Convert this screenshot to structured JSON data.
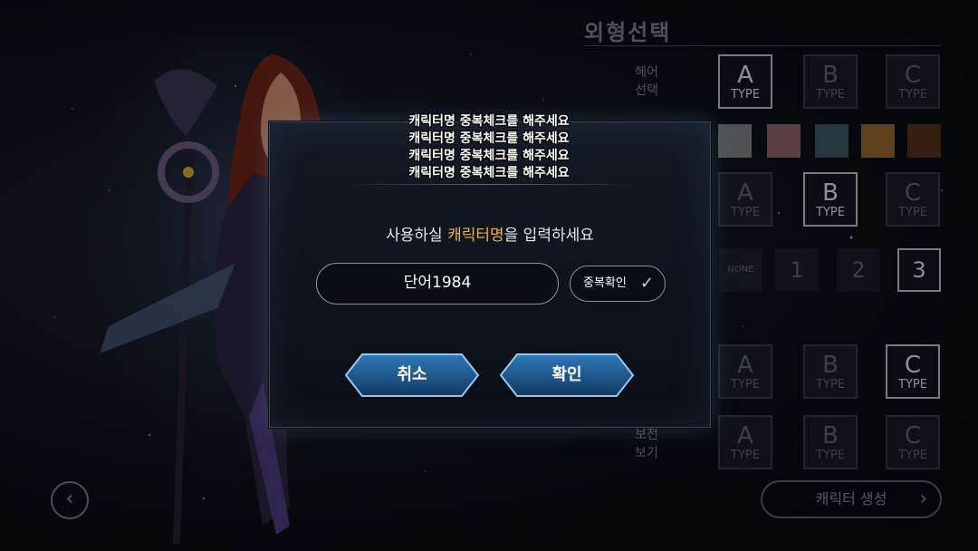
{
  "dialog": {
    "dup_messages": [
      "캐릭터명 중복체크를 해주세요",
      "캐릭터명 중복체크를 해주세요",
      "캐릭터명 중복체크를 해주세요",
      "캐릭터명 중복체크를 해주세요"
    ],
    "prompt_prefix": "사용하실 ",
    "prompt_highlight": "캐릭터명",
    "prompt_suffix": "을 입력하세요",
    "name_value": "단어1984",
    "check_label": "중복확인",
    "cancel_label": "취소",
    "confirm_label": "확인"
  },
  "panel": {
    "title": "외형선택",
    "hair_label_1": "헤어",
    "hair_label_2": "선택",
    "view_label_1": "보전",
    "view_label_2": "보기",
    "type_word": "TYPE",
    "letters": [
      "A",
      "B",
      "C"
    ],
    "none_label": "NONE",
    "numbers": [
      "1",
      "2",
      "3"
    ],
    "swatches": [
      "#8c8c8c",
      "#a06a6e",
      "#3f5b67",
      "#a56e2e",
      "#5e3316"
    ],
    "create_label": "캐릭터 생성"
  },
  "colors": {
    "accent": "#f0b43a",
    "button_blue": "#1f5f9a"
  }
}
